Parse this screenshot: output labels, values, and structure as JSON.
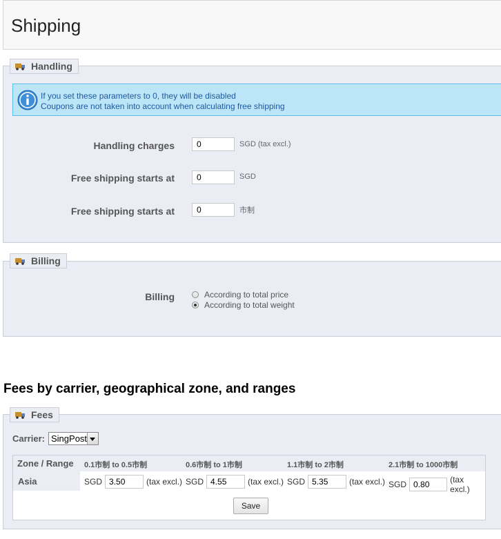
{
  "page": {
    "title": "Shipping"
  },
  "handling": {
    "legend": "Handling",
    "info_lines": [
      "If you set these parameters to 0, they will be disabled",
      "Coupons are not taken into account when calculating free shipping"
    ],
    "fields": [
      {
        "label": "Handling charges",
        "value": "0",
        "unit": "SGD (tax excl.)"
      },
      {
        "label": "Free shipping starts at",
        "value": "0",
        "unit": "SGD"
      },
      {
        "label": "Free shipping starts at",
        "value": "0",
        "unit": "市制"
      }
    ]
  },
  "billing": {
    "legend": "Billing",
    "label": "Billing",
    "options": [
      {
        "label": "According to total price",
        "checked": false
      },
      {
        "label": "According to total weight",
        "checked": true
      }
    ]
  },
  "fees_section": {
    "title": "Fees by carrier, geographical zone, and ranges",
    "legend": "Fees",
    "carrier_label": "Carrier:",
    "carrier_value": "SingPost",
    "table": {
      "zone_header": "Zone / Range",
      "ranges": [
        "0.1市制 to 0.5市制",
        "0.6市制 to 1市制",
        "1.1市制 to 2市制",
        "2.1市制 to 1000市制"
      ],
      "zone": "Asia",
      "currency": "SGD",
      "tax_note": "(tax excl.)",
      "values": [
        "3.50",
        "4.55",
        "5.35",
        "0.80"
      ]
    },
    "save_label": "Save"
  },
  "colors": {
    "panel_bg": "#ebedf4",
    "info_bg": "#bde5f8",
    "info_text": "#1e5aa0"
  },
  "icons": {
    "legend_icon": "truck-icon",
    "info_icon": "info-icon"
  }
}
